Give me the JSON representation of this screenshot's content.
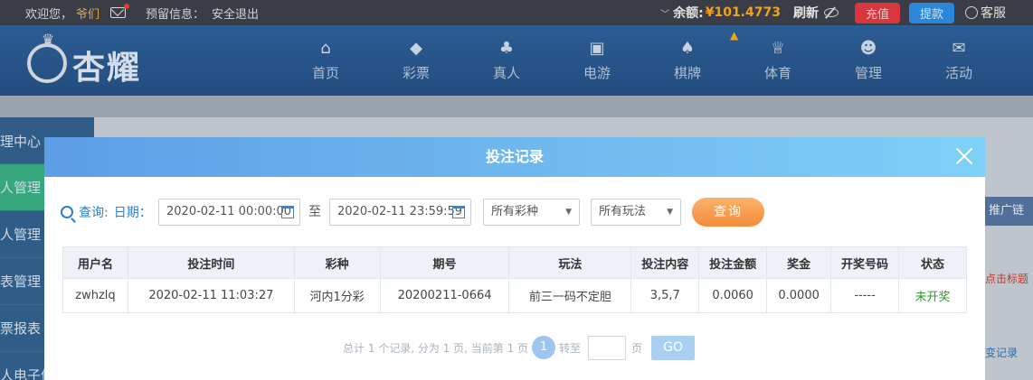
{
  "topbar": {
    "welcome": "欢迎您，",
    "username": "爷们",
    "reserve_label": "预留信息：",
    "logout": "安全退出",
    "balance_label": "余额:",
    "balance_value": "¥101.4773",
    "refresh": "刷新",
    "recharge": "充值",
    "withdraw": "提款",
    "customer_service": "客服"
  },
  "header": {
    "logo_text": "杏耀",
    "nav": [
      {
        "label": "首页",
        "icon": "home-icon"
      },
      {
        "label": "彩票",
        "icon": "ticket-icon"
      },
      {
        "label": "真人",
        "icon": "live-dealer-icon"
      },
      {
        "label": "电游",
        "icon": "slot-machine-icon"
      },
      {
        "label": "棋牌",
        "icon": "cards-icon"
      },
      {
        "label": "体育",
        "icon": "trophy-icon"
      },
      {
        "label": "管理",
        "icon": "users-icon"
      },
      {
        "label": "活动",
        "icon": "gift-icon"
      }
    ]
  },
  "sidebar": {
    "items": [
      "理中心",
      "人管理",
      "人管理",
      "表管理",
      "票报表",
      "人电子体"
    ]
  },
  "behind": {
    "promo": "推广链",
    "hint": "点击标题",
    "record": "变记录"
  },
  "modal": {
    "title": "投注记录",
    "query_label": "查询:",
    "date_label": "日期：",
    "start_date": "2020-02-11 00:00:00",
    "to": "至",
    "end_date": "2020-02-11 23:59:59",
    "lottery_select": "所有彩种",
    "play_select": "所有玩法",
    "query_button": "查询",
    "table": {
      "headers": [
        "用户名",
        "投注时间",
        "彩种",
        "期号",
        "玩法",
        "投注内容",
        "投注金额",
        "奖金",
        "开奖号码",
        "状态"
      ],
      "rows": [
        [
          "zwhzlq",
          "2020-02-11 11:03:27",
          "河内1分彩",
          "20200211-0664",
          "前三一码不定胆",
          "3,5,7",
          "0.0060",
          "0.0000",
          "-----",
          "未开奖"
        ]
      ]
    },
    "pager": {
      "summary": "总计 1 个记录, 分为 1 页, 当前第 1 页",
      "current_page": "1",
      "goto": "转至",
      "page_unit": "页",
      "go": "GO"
    }
  },
  "colors": {
    "topbar": "#3a3d45",
    "header": "#2b5c92",
    "modal_header_start": "#5d9ee6",
    "modal_header_end": "#7fd0f7",
    "query_button": "#f48b3a",
    "status_pending": "#2e9a2e"
  }
}
